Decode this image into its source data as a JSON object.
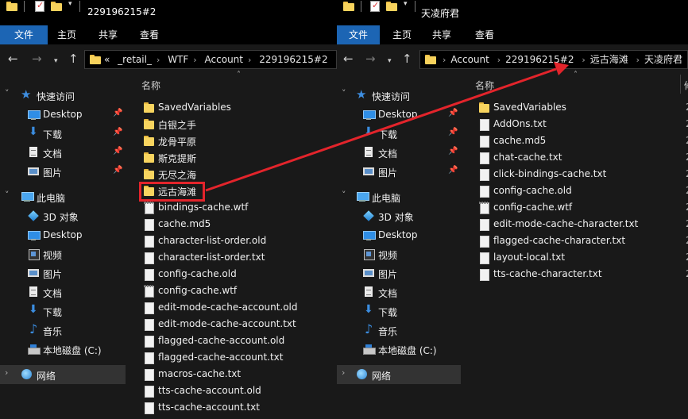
{
  "left": {
    "title": "229196215#2",
    "tabs": [
      "文件",
      "主页",
      "共享",
      "查看"
    ],
    "breadcrumb": [
      "«",
      "_retail_",
      "WTF",
      "Account",
      "229196215#2"
    ],
    "column_name": "名称",
    "nav": {
      "quick_access": "快速访问",
      "quick_items": [
        "Desktop",
        "下载",
        "文档",
        "图片"
      ],
      "this_pc": "此电脑",
      "pc_items": [
        "3D 对象",
        "Desktop",
        "视频",
        "图片",
        "文档",
        "下载",
        "音乐",
        "本地磁盘 (C:)"
      ],
      "network": "网络"
    },
    "files": [
      {
        "name": "SavedVariables",
        "type": "folder"
      },
      {
        "name": "白银之手",
        "type": "folder"
      },
      {
        "name": "龙骨平原",
        "type": "folder"
      },
      {
        "name": "斯克提斯",
        "type": "folder"
      },
      {
        "name": "无尽之海",
        "type": "folder"
      },
      {
        "name": "远古海滩",
        "type": "folder"
      },
      {
        "name": "bindings-cache.wtf",
        "type": "cfg"
      },
      {
        "name": "cache.md5",
        "type": "file"
      },
      {
        "name": "character-list-order.old",
        "type": "file"
      },
      {
        "name": "character-list-order.txt",
        "type": "file"
      },
      {
        "name": "config-cache.old",
        "type": "file"
      },
      {
        "name": "config-cache.wtf",
        "type": "cfg"
      },
      {
        "name": "edit-mode-cache-account.old",
        "type": "file"
      },
      {
        "name": "edit-mode-cache-account.txt",
        "type": "file"
      },
      {
        "name": "flagged-cache-account.old",
        "type": "file"
      },
      {
        "name": "flagged-cache-account.txt",
        "type": "file"
      },
      {
        "name": "macros-cache.txt",
        "type": "file"
      },
      {
        "name": "tts-cache-account.old",
        "type": "file"
      },
      {
        "name": "tts-cache-account.txt",
        "type": "file"
      }
    ]
  },
  "right": {
    "title": "天凌府君",
    "tabs": [
      "文件",
      "主页",
      "共享",
      "查看"
    ],
    "breadcrumb": [
      "Account",
      "229196215#2",
      "远古海滩",
      "天凌府君"
    ],
    "column_name": "名称",
    "column_date_partial": "修",
    "nav": {
      "quick_access": "快速访问",
      "quick_items": [
        "Desktop",
        "下载",
        "文档",
        "图片"
      ],
      "this_pc": "此电脑",
      "pc_items": [
        "3D 对象",
        "Desktop",
        "视频",
        "图片",
        "文档",
        "下载",
        "音乐",
        "本地磁盘 (C:)"
      ],
      "network": "网络"
    },
    "date_partial": "2",
    "files": [
      {
        "name": "SavedVariables",
        "type": "folder"
      },
      {
        "name": "AddOns.txt",
        "type": "file"
      },
      {
        "name": "cache.md5",
        "type": "file"
      },
      {
        "name": "chat-cache.txt",
        "type": "file"
      },
      {
        "name": "click-bindings-cache.txt",
        "type": "file"
      },
      {
        "name": "config-cache.old",
        "type": "file"
      },
      {
        "name": "config-cache.wtf",
        "type": "cfg"
      },
      {
        "name": "edit-mode-cache-character.txt",
        "type": "file"
      },
      {
        "name": "flagged-cache-character.txt",
        "type": "file"
      },
      {
        "name": "layout-local.txt",
        "type": "file"
      },
      {
        "name": "tts-cache-character.txt",
        "type": "file"
      }
    ]
  },
  "annotation": {
    "color": "#e3242b",
    "highlighted": "远古海滩"
  },
  "colors": {
    "accent": "#1c65b4",
    "background": "#191919",
    "titlebar": "#000000"
  }
}
